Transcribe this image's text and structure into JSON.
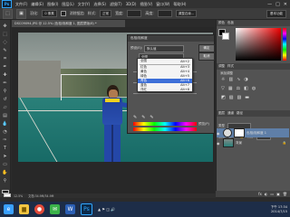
{
  "app": {
    "logo": "Ps"
  },
  "menubar": {
    "items": [
      "文件(F)",
      "编辑(E)",
      "图像(I)",
      "图层(L)",
      "文字(Y)",
      "选择(S)",
      "滤镜(T)",
      "3D(D)",
      "视图(V)",
      "窗口(W)",
      "帮助(H)"
    ],
    "min": "—",
    "max": "□",
    "close": "✕"
  },
  "options": {
    "feather_label": "羽化:",
    "feather_value": "0 像素",
    "antialias": "消除锯齿",
    "style_label": "样式:",
    "style_value": "正常",
    "width_label": "宽度:",
    "height_label": "高度:",
    "refine": "调整边缘...",
    "workspace": "基本功能"
  },
  "document": {
    "tab": "DSC09094.JPG @ 12.5% (色相/饱和度 1, 图层蒙版/8) *",
    "zoom": "12.5%",
    "docsize": "文档:34.9M/34.9M"
  },
  "dialog": {
    "title": "色相/饱和度",
    "preset_label": "预设(E):",
    "preset_value": "默认值",
    "channel_value": "全图",
    "ok": "确定",
    "cancel": "取消",
    "preview": "预览(P)",
    "eyedroppers": [
      "✎",
      "✎",
      "✎"
    ]
  },
  "dropdown": {
    "items": [
      {
        "label": "全图",
        "key": "Alt+2",
        "selected": false
      },
      {
        "label": "红色",
        "key": "Alt+3",
        "selected": false
      },
      {
        "label": "黄色",
        "key": "Alt+4",
        "selected": false
      },
      {
        "label": "绿色",
        "key": "Alt+5",
        "selected": false
      },
      {
        "label": "青色",
        "key": "Alt+6",
        "selected": true
      },
      {
        "label": "蓝色",
        "key": "Alt+7",
        "selected": false
      },
      {
        "label": "洋红",
        "key": "Alt+8",
        "selected": false
      }
    ]
  },
  "panels": {
    "color_tabs": [
      "颜色",
      "色板"
    ],
    "adjust_tabs": [
      "调整",
      "样式"
    ],
    "adjust_title": "添加调整",
    "layers_tabs": [
      "图层",
      "通道",
      "路径"
    ],
    "kind_label": "类型",
    "blend_mode": "正常",
    "opacity_label": "不透明度:",
    "opacity_value": "100%",
    "lock_label": "锁定:",
    "fill_label": "填充:",
    "fill_value": "100%",
    "layers": [
      {
        "name": "色相/饱和度 1",
        "selected": true
      },
      {
        "name": "背景",
        "selected": false
      }
    ],
    "footer_icons": [
      "fx",
      "◐",
      "▭",
      "▣",
      "🗑"
    ]
  },
  "taskbar": {
    "apps": [
      {
        "name": "ie",
        "glyph": "e",
        "color": "#3aa0ff"
      },
      {
        "name": "explorer",
        "glyph": "▆",
        "color": "#f4c542"
      },
      {
        "name": "chrome",
        "glyph": "●",
        "color": "#e34a3a"
      },
      {
        "name": "wechat",
        "glyph": "✉",
        "color": "#3bb34a"
      },
      {
        "name": "word",
        "glyph": "W",
        "color": "#2b5fb4"
      },
      {
        "name": "photoshop",
        "glyph": "Ps",
        "color": "#0b2a4a"
      }
    ],
    "time": "下午 17:34",
    "date": "2014/7/15"
  }
}
